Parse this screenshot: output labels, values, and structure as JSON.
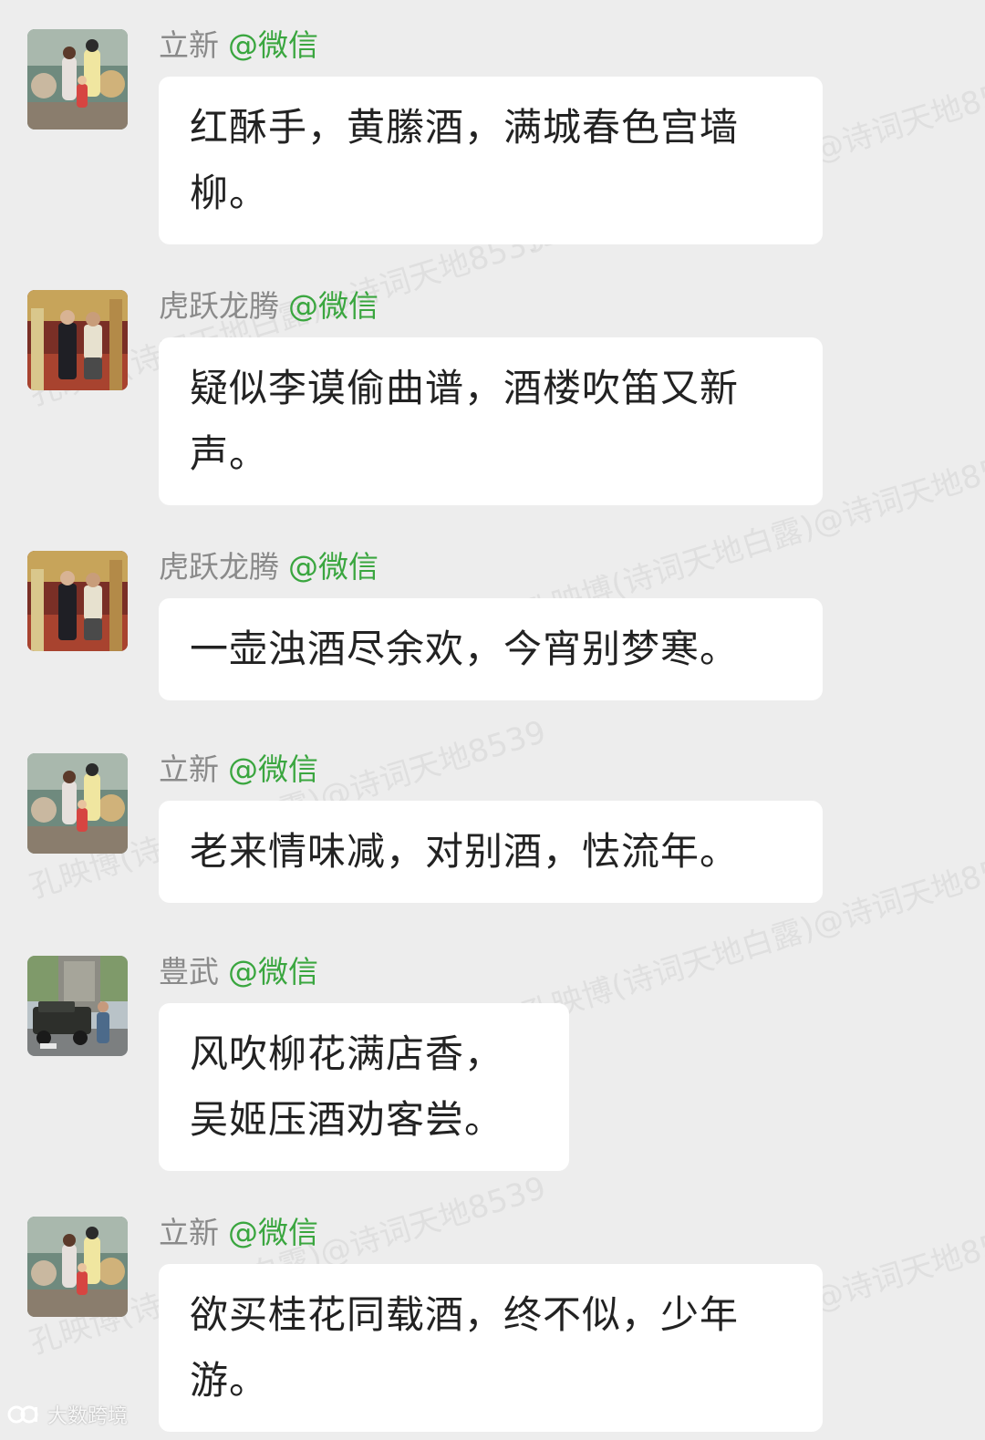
{
  "messages": [
    {
      "sender": "立新",
      "source": "@微信",
      "lines": [
        "红酥手，黄縢酒，满城春色宫墙",
        "柳。"
      ]
    },
    {
      "sender": "虎跃龙腾",
      "source": "@微信",
      "lines": [
        "疑似李谟偷曲谱，酒楼吹笛又新",
        "声。"
      ]
    },
    {
      "sender": "虎跃龙腾",
      "source": "@微信",
      "lines": [
        "一壶浊酒尽余欢，今宵别梦寒。"
      ]
    },
    {
      "sender": "立新",
      "source": "@微信",
      "lines": [
        "老来情味减，对别酒，怯流年。"
      ]
    },
    {
      "sender": "豊武",
      "source": "@微信",
      "lines": [
        "风吹柳花满店香，",
        "吴姬压酒劝客尝。"
      ]
    },
    {
      "sender": "立新",
      "source": "@微信",
      "lines": [
        "欲买桂花同载酒，终不似，少年",
        "游。"
      ]
    }
  ],
  "watermarks": {
    "w1": "孔映博(诗词天地白露)@诗词天地8539",
    "w2": "孔映博(诗词天地白露)@诗词天地8539",
    "w3": "孔映博(诗词天地白露)@诗词天地8539",
    "w4": "孔映博(诗词天地白露)@诗词天地8539",
    "w5": "孔映博(诗词天地白露)@诗词天地8539",
    "w6": "孔映博(诗词天地白露)@诗词天地8539",
    "w7": "孔映博(诗词天地白露)@诗词天地8539"
  },
  "corner_logo": {
    "text": "大数跨境",
    "icon": "logo-mark-icon"
  },
  "colors": {
    "background": "#ededed",
    "bubble": "#ffffff",
    "sender_name": "#8a8a8a",
    "source_tag": "#3aa63f",
    "message_text": "#222222"
  }
}
